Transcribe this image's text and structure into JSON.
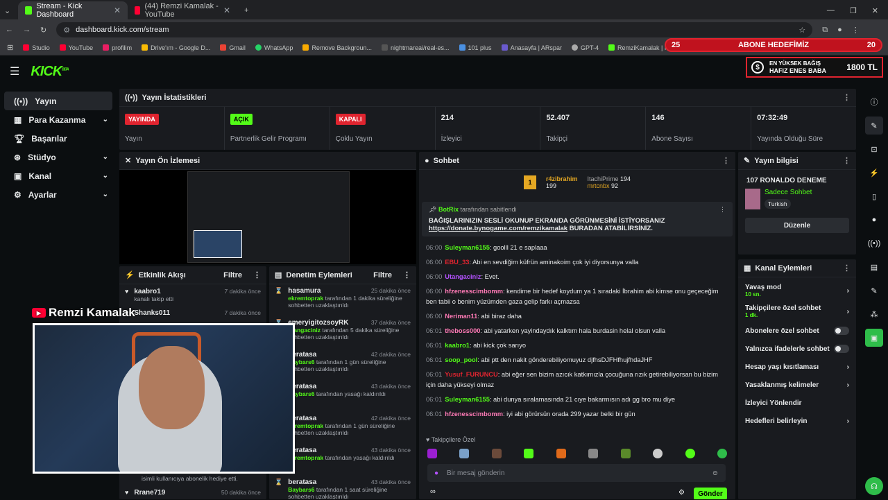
{
  "browser": {
    "tabs": [
      {
        "title": "Stream - Kick Dashboard",
        "active": true
      },
      {
        "title": "(44) Remzi Kamalak - YouTube",
        "active": false
      }
    ],
    "url": "dashboard.kick.com/stream",
    "bookmarks": [
      "Studio",
      "YouTube",
      "profilim",
      "Drive'ım - Google D...",
      "Gmail",
      "WhatsApp",
      "Remove Backgroun...",
      "nightmareai/real-es...",
      "101 plus",
      "Anasayfa | ARspar",
      "GPT-4",
      "RemziKamalak | Kick"
    ]
  },
  "overlay": {
    "goal_left": "25",
    "goal_label": "ABONE HEDEFİMİZ",
    "goal_right": "20",
    "top_donor_label_1": "EN YÜKSEK BAĞIŞ",
    "top_donor_name": "HAFIZ ENES BABA",
    "top_donor_amount": "1800 TL",
    "watermark": "Remzi Kamalak"
  },
  "app": {
    "logo": "KICK",
    "beta": "BETA"
  },
  "sidebar": {
    "items": [
      {
        "label": "Yayın",
        "active": true
      },
      {
        "label": "Para Kazanma",
        "chev": true
      },
      {
        "label": "Başarılar"
      },
      {
        "label": "Stüdyo",
        "chev": true
      },
      {
        "label": "Kanal",
        "chev": true
      },
      {
        "label": "Ayarlar",
        "chev": true
      }
    ]
  },
  "stats": {
    "title": "Yayın İstatistikleri",
    "items": [
      {
        "badge": "YAYINDA",
        "label": "Yayın"
      },
      {
        "badge": "AÇIK",
        "label": "Partnerlik Gelir Programı"
      },
      {
        "badge": "KAPALI",
        "label": "Çoklu Yayın"
      },
      {
        "value": "214",
        "label": "İzleyici"
      },
      {
        "value": "52.407",
        "label": "Takipçi"
      },
      {
        "value": "146",
        "label": "Abone Sayısı"
      },
      {
        "value": "07:32:49",
        "label": "Yayında Olduğu Süre"
      }
    ]
  },
  "preview": {
    "title": "Yayın Ön İzlemesi"
  },
  "activity": {
    "title": "Etkinlik Akışı",
    "filter": "Filtre",
    "items": [
      {
        "name": "kaabro1",
        "sub": "kanalı takip etti",
        "time": "7 dakika önce"
      },
      {
        "name": "Shanks011",
        "sub": "",
        "time": "7 dakika önce"
      },
      {
        "name": "",
        "sub": "isimli kullanıcıya abonelik hediye etti.",
        "time": ""
      },
      {
        "name": "Rrane719",
        "sub": "",
        "time": "50 dakika önce"
      }
    ]
  },
  "moderation": {
    "title": "Denetim Eylemleri",
    "filter": "Filtre",
    "items": [
      {
        "name": "hasamura",
        "mod": "ekremtoprak",
        "sub": "tarafından 1 dakika süreliğine sohbetten uzaklaştırıldı",
        "time": "25 dakika önce"
      },
      {
        "name": "emeryigitozsoyRK",
        "mod": "utangaciniz",
        "sub": "tarafından 5 dakika süreliğine sohbetten uzaklaştırıldı",
        "time": "37 dakika önce"
      },
      {
        "name": "beratasa",
        "mod": "Baybars6",
        "sub": "tarafından 1 gün süreliğine sohbetten uzaklaştırıldı",
        "time": "42 dakika önce"
      },
      {
        "name": "beratasa",
        "mod": "Baybars6",
        "sub": "tarafından yasağı kaldırıldı",
        "time": "43 dakika önce"
      },
      {
        "name": "beratasa",
        "mod": "ekremtoprak",
        "sub": "tarafından 1 gün süreliğine sohbetten uzaklaştırıldı",
        "time": "42 dakika önce"
      },
      {
        "name": "beratasa",
        "mod": "ekremtoprak",
        "sub": "tarafından yasağı kaldırıldı",
        "time": "43 dakika önce"
      },
      {
        "name": "beratasa",
        "mod": "Baybars6",
        "sub": "tarafından 1 saat süreliğine sohbetten uzaklaştırıldı",
        "time": "43 dakika önce"
      }
    ]
  },
  "chat": {
    "title": "Sohbet",
    "leaders": [
      {
        "name": "r4zibrahim",
        "count": "199"
      },
      {
        "name": "ItachiPrime",
        "count": "194"
      },
      {
        "name": "mrtcnbx",
        "count": "92"
      }
    ],
    "pinned_by": "BotRix",
    "pinned_suffix": "tarafından sabitlendi",
    "pinned_text": "BAĞIŞLARINIZIN SESLİ OKUNUP EKRANDA GÖRÜNMESİNİ İSTİYORSANIZ",
    "pinned_link": "https://donate.bynogame.com/remzikamalak",
    "pinned_tail": "BURADAN ATABİLİRSİNİZ.",
    "messages": [
      {
        "t": "06:00",
        "u": "Suleyman6155",
        "c": "#53fc18",
        "m": "goolll 21 e saplaaa"
      },
      {
        "t": "06:00",
        "u": "EBU_33",
        "c": "#e0242f",
        "m": "Abi en sevdiğim küfrün aminakoim çok iyi diyorsunya valla"
      },
      {
        "t": "06:00",
        "u": "Utangaciniz",
        "c": "#b452ff",
        "m": "Evet."
      },
      {
        "t": "06:00",
        "u": "hfzenesscimbomm",
        "c": "#ff7ab6",
        "m": "kendime bir hedef koydum ya 1 sıradaki İbrahim abi kimse onu geçeceğim ben tabii o benim yüzümden gaza gelip farkı açmazsa"
      },
      {
        "t": "06:00",
        "u": "Neriman11",
        "c": "#ff7ab6",
        "m": "abi biraz daha"
      },
      {
        "t": "06:01",
        "u": "theboss000",
        "c": "#ff7ab6",
        "m": "abi yatarken yayindaydık kalktım hala burdasin helal olsun valla"
      },
      {
        "t": "06:01",
        "u": "kaabro1",
        "c": "#53fc18",
        "m": "abi kick çok sarıyo"
      },
      {
        "t": "06:01",
        "u": "soop_pool",
        "c": "#53fc18",
        "m": "abi ptt den nakit gönderebiliyomuyuz djfhsDJFHfhujfhdaJHF"
      },
      {
        "t": "06:01",
        "u": "Yusuf_FURUNCU",
        "c": "#e0242f",
        "m": "abi eğer sen bizim azıcık katkımızla çocuğuna rızık getirebiliyorsan bu bizim için daha yükseyi olmaz"
      },
      {
        "t": "06:01",
        "u": "Suleyman6155",
        "c": "#53fc18",
        "m": "abi dunya sıralamasında 21 cıye bakarmısın adı gg bro mu diye"
      },
      {
        "t": "06:01",
        "u": "hfzenesscimbomm",
        "c": "#ff7ab6",
        "m": "iyi abi görürsün orada 299 yazar belki bir gün"
      }
    ],
    "followers_only": "Takipçilere Özel",
    "placeholder": "Bir mesaj gönderin",
    "send": "Gönder"
  },
  "info": {
    "title": "Yayın bilgisi",
    "stream_title": "107 RONALDO DENEME",
    "category": "Sadece Sohbet",
    "tag": "Turkish",
    "edit": "Düzenle"
  },
  "channel": {
    "title": "Kanal Eylemleri",
    "rows": [
      {
        "label": "Yavaş mod",
        "sub": "10 sn.",
        "type": "chev"
      },
      {
        "label": "Takipçilere özel sohbet",
        "sub": "1 dk.",
        "type": "chev"
      },
      {
        "label": "Abonelere özel sohbet",
        "type": "toggle"
      },
      {
        "label": "Yalnızca ifadelerle sohbet",
        "type": "toggle"
      },
      {
        "label": "Hesap yaşı kısıtlaması",
        "type": "chev"
      },
      {
        "label": "Yasaklanmış kelimeler",
        "type": "chev"
      },
      {
        "label": "İzleyici Yönlendir",
        "type": "none"
      },
      {
        "label": "Hedefleri belirleyin",
        "type": "chev"
      }
    ]
  }
}
